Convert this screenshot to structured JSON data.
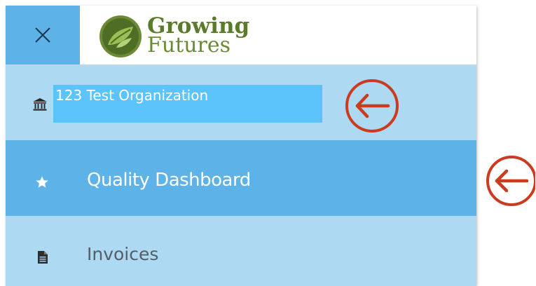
{
  "logo": {
    "line1": "Growing",
    "line2": "Futures"
  },
  "menu": {
    "organization": "123 Test Organization",
    "items": [
      {
        "label": "Quality Dashboard",
        "icon": "star-icon",
        "active": true
      },
      {
        "label": "Invoices",
        "icon": "document-icon",
        "active": false
      }
    ]
  },
  "colors": {
    "active_item": "#5db3e8",
    "item_bg": "#add9f3",
    "highlight": "#5cc4fb",
    "annotation_arrow": "#cc3b1f",
    "logo_green": "#5a7a2c"
  }
}
